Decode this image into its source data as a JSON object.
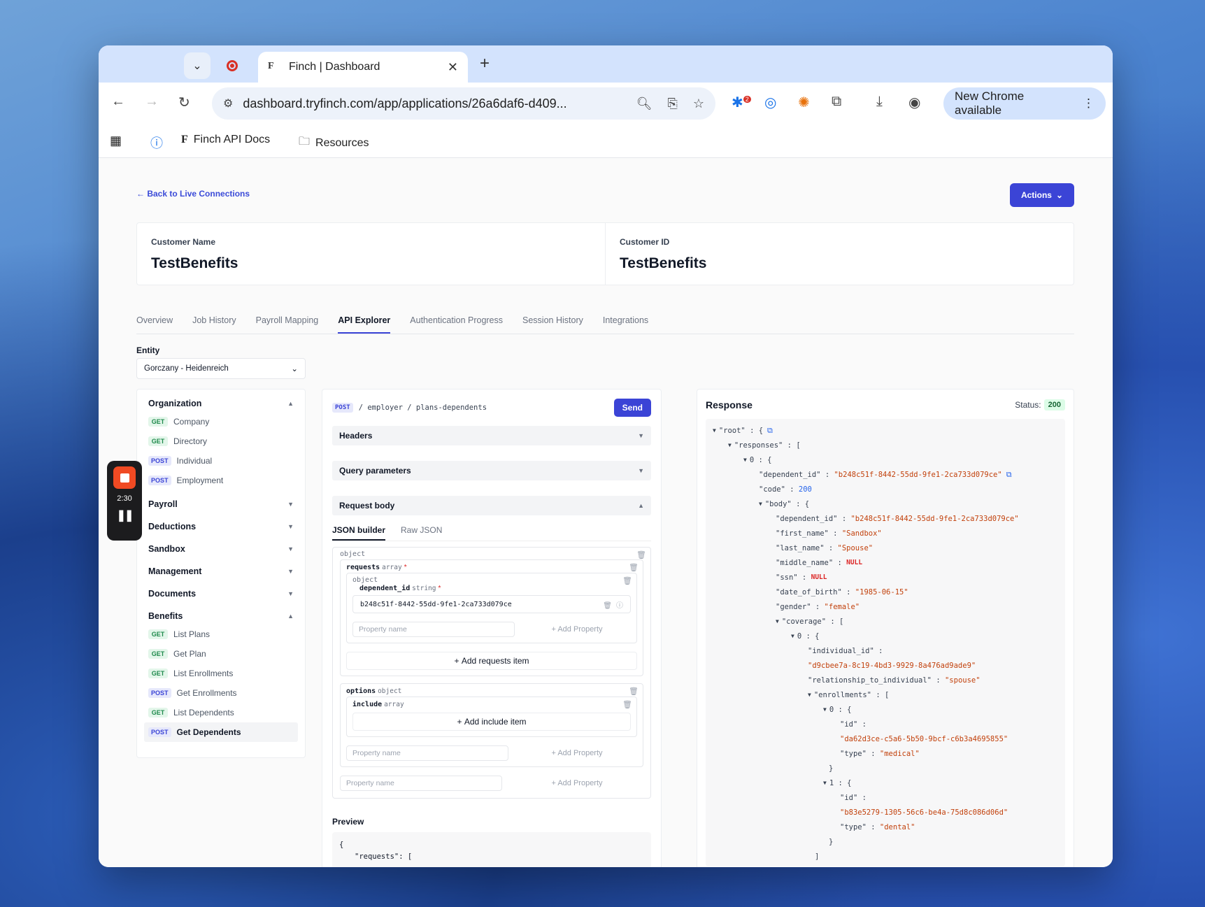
{
  "browser": {
    "tab_title": "Finch | Dashboard",
    "url": "dashboard.tryfinch.com/app/applications/26a6daf6-d409...",
    "new_chrome": "New Chrome available",
    "ext_badge": "2",
    "bookmarks": [
      "Finch API Docs",
      "Resources"
    ]
  },
  "header": {
    "back_link": "Back to Live Connections",
    "actions_label": "Actions"
  },
  "customer": {
    "name_label": "Customer Name",
    "name_value": "TestBenefits",
    "id_label": "Customer ID",
    "id_value": "TestBenefits"
  },
  "tabs": [
    "Overview",
    "Job History",
    "Payroll Mapping",
    "API Explorer",
    "Authentication Progress",
    "Session History",
    "Integrations"
  ],
  "active_tab": "API Explorer",
  "entity": {
    "label": "Entity",
    "value": "Gorczany - Heidenreich"
  },
  "recorder": {
    "time": "2:30"
  },
  "sidebar": {
    "organization": {
      "title": "Organization",
      "items": [
        {
          "method": "GET",
          "label": "Company"
        },
        {
          "method": "GET",
          "label": "Directory"
        },
        {
          "method": "POST",
          "label": "Individual"
        },
        {
          "method": "POST",
          "label": "Employment"
        }
      ]
    },
    "collapsed_sections": [
      "Payroll",
      "Deductions",
      "Sandbox",
      "Management",
      "Documents"
    ],
    "benefits": {
      "title": "Benefits",
      "items": [
        {
          "method": "GET",
          "label": "List Plans"
        },
        {
          "method": "GET",
          "label": "Get Plan"
        },
        {
          "method": "GET",
          "label": "List Enrollments"
        },
        {
          "method": "POST",
          "label": "Get Enrollments"
        },
        {
          "method": "GET",
          "label": "List Dependents"
        },
        {
          "method": "POST",
          "label": "Get Dependents"
        }
      ]
    }
  },
  "request": {
    "method": "POST",
    "path": "/ employer / plans-dependents",
    "send_label": "Send",
    "headers_label": "Headers",
    "query_label": "Query parameters",
    "body_label": "Request body",
    "subtab_builder": "JSON builder",
    "subtab_raw": "Raw JSON",
    "t_object": "object",
    "t_array": "array",
    "t_string": "string",
    "req_mark": "*",
    "key_requests": "requests",
    "key_dependent_id": "dependent_id",
    "dependent_id_value": "b248c51f-8442-55dd-9fe1-2ca733d079ce",
    "key_options": "options",
    "key_include": "include",
    "property_placeholder": "Property name",
    "add_property": "Add Property",
    "add_requests_item": "Add requests item",
    "add_include_item": "Add include item",
    "preview_label": "Preview",
    "preview_line1": "{",
    "preview_line2": "\"requests\": ["
  },
  "response": {
    "title": "Response",
    "status_label": "Status:",
    "status_code": "200",
    "tree": {
      "root": "\"root\" : {",
      "responses": "\"responses\" : [",
      "idx0": "0 : {",
      "dependent_id_key": "\"dependent_id\" :",
      "dependent_id_val": "\"b248c51f-8442-55dd-9fe1-2ca733d079ce\"",
      "code_key": "\"code\" :",
      "code_val": "200",
      "body": "\"body\" : {",
      "b_dependent_id_key": "\"dependent_id\" :",
      "b_dependent_id_val": "\"b248c51f-8442-55dd-9fe1-2ca733d079ce\"",
      "first_name_key": "\"first_name\" :",
      "first_name_val": "\"Sandbox\"",
      "last_name_key": "\"last_name\" :",
      "last_name_val": "\"Spouse\"",
      "middle_name_key": "\"middle_name\" :",
      "null_val": "NULL",
      "ssn_key": "\"ssn\" :",
      "dob_key": "\"date_of_birth\" :",
      "dob_val": "\"1985-06-15\"",
      "gender_key": "\"gender\" :",
      "gender_val": "\"female\"",
      "coverage": "\"coverage\" : [",
      "cov0": "0 : {",
      "individual_id_key": "\"individual_id\" :",
      "individual_id_val": "\"d9cbee7a-8c19-4bd3-9929-8a476ad9ade9\"",
      "rel_key": "\"relationship_to_individual\" :",
      "rel_val": "\"spouse\"",
      "enrollments": "\"enrollments\" : [",
      "en0": "0 : {",
      "id_key": "\"id\" :",
      "en0_id": "\"da62d3ce-c5a6-5b50-9bcf-c6b3a4695855\"",
      "type_key": "\"type\" :",
      "en0_type": "\"medical\"",
      "close_brace": "}",
      "en1": "1 : {",
      "en1_id": "\"b83e5279-1305-56c6-be4a-75d8c086d06d\"",
      "en1_type": "\"dental\"",
      "close_bracket": "]"
    }
  }
}
